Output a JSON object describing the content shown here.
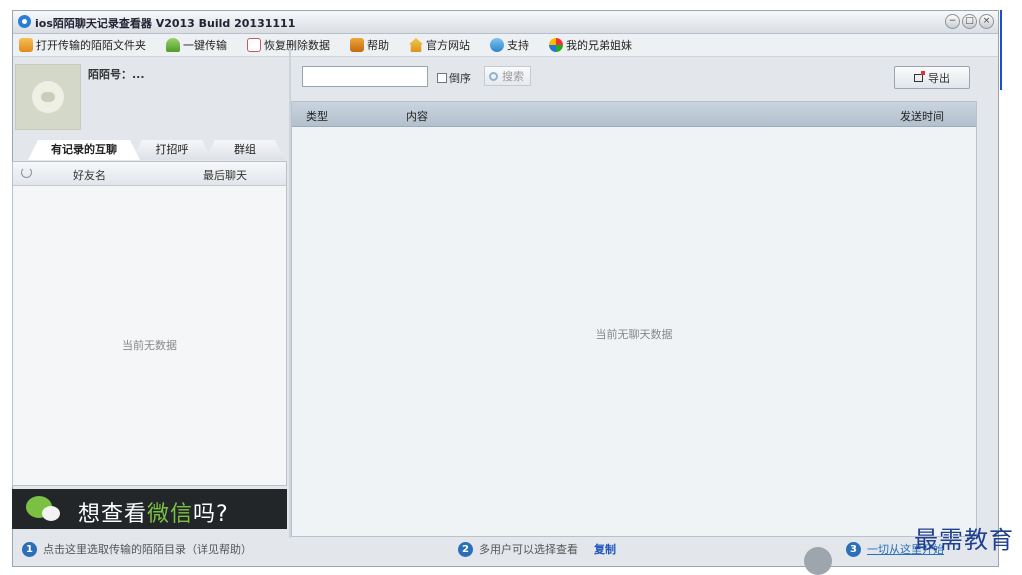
{
  "window": {
    "title": "ios陌陌聊天记录查看器 V2013 Build 20131111",
    "controls": [
      "−",
      "□",
      "×"
    ]
  },
  "menu": {
    "items": [
      {
        "label": "打开传输的陌陌文件夹",
        "icon": "folder-icon"
      },
      {
        "label": "一键传输",
        "icon": "transfer-icon"
      },
      {
        "label": "恢复删除数据",
        "icon": "restore-icon"
      },
      {
        "label": "帮助",
        "icon": "help-book-icon"
      },
      {
        "label": "官方网站",
        "icon": "home-icon"
      },
      {
        "label": "支持",
        "icon": "support-icon"
      },
      {
        "label": "我的兄弟姐妹",
        "icon": "colorful-ball-icon"
      }
    ]
  },
  "profile": {
    "id_label": "陌陌号：..."
  },
  "tabs": [
    {
      "label": "有记录的互聊",
      "active": true
    },
    {
      "label": "打招呼",
      "active": false
    },
    {
      "label": "群组",
      "active": false
    }
  ],
  "friend_list": {
    "columns": [
      "好友名",
      "最后聊天"
    ],
    "empty_text": "当前无数据"
  },
  "banner": {
    "text_prefix": "想查看",
    "text_highlight": "微信",
    "text_suffix": "吗?"
  },
  "toolbar": {
    "search_value": "",
    "reverse_label": "倒序",
    "search_label": "搜索",
    "export_label": "导出"
  },
  "chat_table": {
    "columns": [
      "类型",
      "内容",
      "发送时间"
    ],
    "empty_text": "当前无聊天数据"
  },
  "status": {
    "step1": {
      "num": "1",
      "text": "点击这里选取传输的陌陌目录（详见帮助）"
    },
    "step2": {
      "num": "2",
      "text": "多用户可以选择查看",
      "link": "复制"
    },
    "step3": {
      "num": "3",
      "text": "一切从这里开始"
    }
  },
  "watermark": "最需教育",
  "colors": {
    "accent_blue": "#2a6fb8",
    "wechat_green": "#7bc043",
    "banner_bg": "#222629"
  }
}
